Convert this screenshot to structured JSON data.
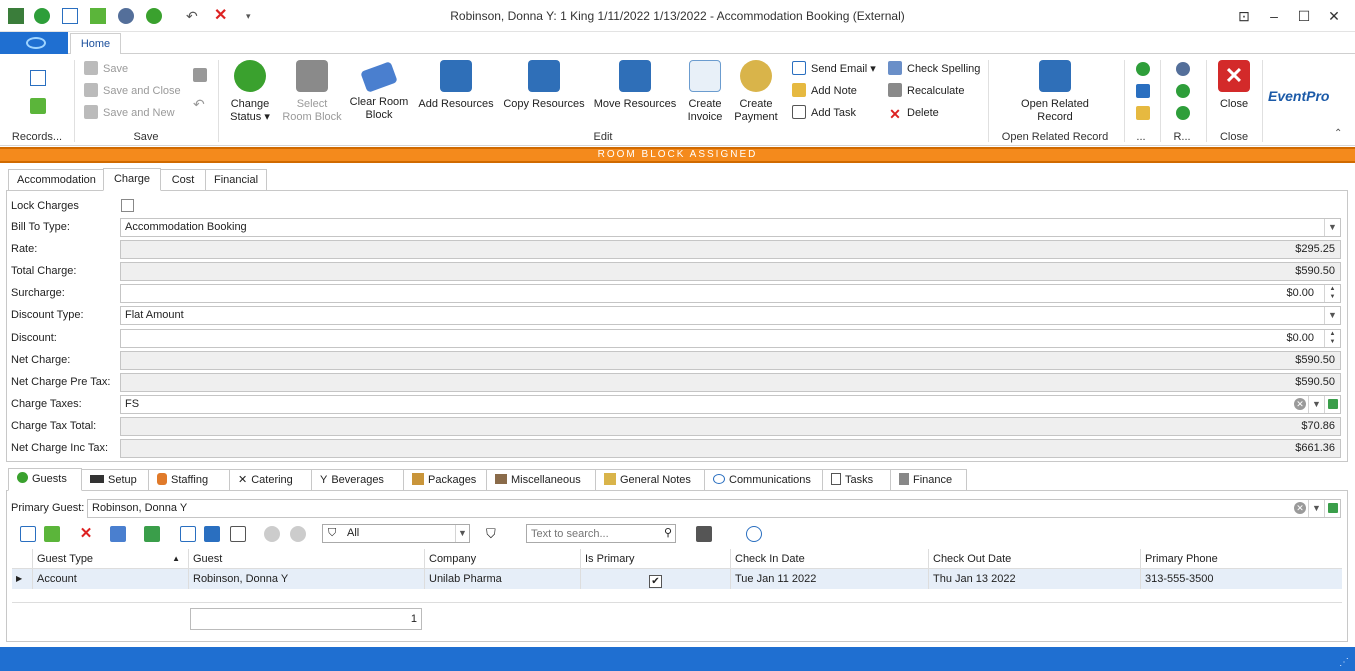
{
  "window": {
    "title": "Robinson, Donna Y: 1 King 1/11/2022 1/13/2022  - Accommodation Booking (External)",
    "colors": {
      "accent": "#1f6fd1",
      "banner": "#f48a1c"
    }
  },
  "ribbon": {
    "home_tab": "Home",
    "groups": {
      "records": "Records...",
      "save": "Save",
      "edit": "Edit",
      "open_related": "Open Related Record",
      "more": "...",
      "r": "R...",
      "close": "Close"
    },
    "save": {
      "save": "Save",
      "save_close": "Save and Close",
      "save_new": "Save and New"
    },
    "edit": {
      "change_status_1": "Change",
      "change_status_2": "Status ▾",
      "select_block_1": "Select",
      "select_block_2": "Room Block",
      "clear_block_1": "Clear Room",
      "clear_block_2": "Block",
      "add_resources": "Add Resources",
      "copy_resources": "Copy Resources",
      "move_resources": "Move Resources",
      "create_invoice_1": "Create",
      "create_invoice_2": "Invoice",
      "create_payment_1": "Create",
      "create_payment_2": "Payment",
      "send_email": "Send Email ▾",
      "add_note": "Add Note",
      "add_task": "Add Task",
      "check_spelling": "Check Spelling",
      "recalculate": "Recalculate",
      "delete": "Delete"
    },
    "open_related_1": "Open Related",
    "open_related_2": "Record",
    "close_label": "Close",
    "brand": "EventPro"
  },
  "banner": "ROOM BLOCK ASSIGNED",
  "tabs_top": [
    "Accommodation",
    "Charge",
    "Cost",
    "Financial"
  ],
  "charge": {
    "lock_charges": "Lock Charges",
    "bill_to_type_label": "Bill To Type:",
    "bill_to_type": "Accommodation Booking",
    "rate_label": "Rate:",
    "rate": "$295.25",
    "total_charge_label": "Total Charge:",
    "total_charge": "$590.50",
    "surcharge_label": "Surcharge:",
    "surcharge": "$0.00",
    "discount_type_label": "Discount Type:",
    "discount_type": "Flat Amount",
    "discount_label": "Discount:",
    "discount": "$0.00",
    "net_charge_label": "Net Charge:",
    "net_charge": "$590.50",
    "net_pre_tax_label": "Net Charge Pre Tax:",
    "net_pre_tax": "$590.50",
    "charge_taxes_label": "Charge Taxes:",
    "charge_taxes": "FS",
    "tax_total_label": "Charge Tax Total:",
    "tax_total": "$70.86",
    "net_inc_tax_label": "Net Charge Inc Tax:",
    "net_inc_tax": "$661.36"
  },
  "tabs_bottom": [
    "Guests",
    "Setup",
    "Staffing",
    "Catering",
    "Beverages",
    "Packages",
    "Miscellaneous",
    "General Notes",
    "Communications",
    "Tasks",
    "Finance"
  ],
  "guests": {
    "primary_guest_label": "Primary Guest:",
    "primary_guest": "Robinson, Donna Y",
    "filter": "All",
    "search_placeholder": "Text to search...",
    "columns": [
      "Guest Type",
      "Guest",
      "Company",
      "Is Primary",
      "Check In Date",
      "Check Out Date",
      "Primary Phone"
    ],
    "row": {
      "type": "Account",
      "guest": "Robinson, Donna Y",
      "company": "Unilab Pharma",
      "is_primary": "✔",
      "check_in": "Tue Jan 11 2022",
      "check_out": "Thu Jan 13 2022",
      "phone": "313-555-3500"
    },
    "count": "1"
  }
}
